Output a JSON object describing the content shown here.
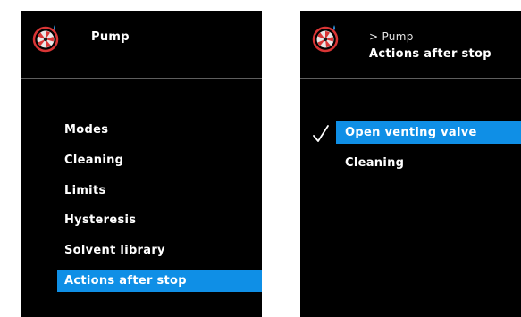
{
  "colors": {
    "screen_bg": "#000000",
    "highlight": "#0f8fe6",
    "text": "#ffffff",
    "divider": "#6e6e6e",
    "icon_red": "#d83535"
  },
  "left_panel": {
    "header_icon": "pump-icon",
    "title": "Pump",
    "menu_items": [
      {
        "label": "Modes",
        "selected": false
      },
      {
        "label": "Cleaning",
        "selected": false
      },
      {
        "label": "Limits",
        "selected": false
      },
      {
        "label": "Hysteresis",
        "selected": false
      },
      {
        "label": "Solvent library",
        "selected": false
      },
      {
        "label": "Actions after stop",
        "selected": true
      }
    ]
  },
  "right_panel": {
    "header_icon": "pump-icon",
    "breadcrumb": "> Pump",
    "title": "Actions after stop",
    "check_icon": "checkmark-icon",
    "options": [
      {
        "label": "Open venting valve",
        "selected": true,
        "checked": true
      },
      {
        "label": "Cleaning",
        "selected": false,
        "checked": false
      }
    ]
  }
}
